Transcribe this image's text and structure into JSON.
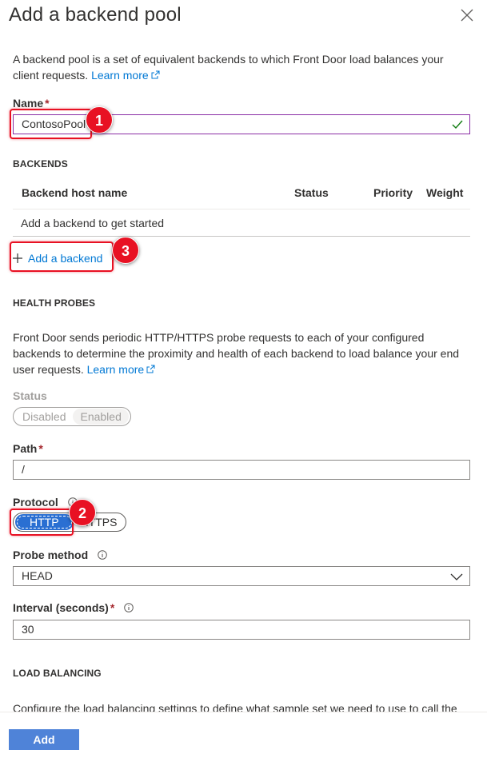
{
  "panel": {
    "title": "Add a backend pool"
  },
  "intro": {
    "text": "A backend pool is a set of equivalent backends to which Front Door load balances your client requests.",
    "link": "Learn more"
  },
  "name_field": {
    "label": "Name",
    "required_mark": "*",
    "value": "ContosoPool"
  },
  "backends": {
    "heading": "BACKENDS",
    "columns": [
      "Backend host name",
      "Status",
      "Priority",
      "Weight"
    ],
    "empty_text": "Add a backend to get started",
    "add_label": "Add a backend"
  },
  "health_probes": {
    "heading": "HEALTH PROBES",
    "text": "Front Door sends periodic HTTP/HTTPS probe requests to each of your configured backends to determine the proximity and health of each backend to load balance your end user requests.",
    "link": "Learn more",
    "status": {
      "label": "Status",
      "options": [
        "Disabled",
        "Enabled"
      ],
      "selected": "Enabled",
      "disabled": true
    },
    "path": {
      "label": "Path",
      "required_mark": "*",
      "value": "/"
    },
    "protocol": {
      "label": "Protocol",
      "options": [
        "HTTP",
        "HTTPS"
      ],
      "selected": "HTTP"
    },
    "probe_method": {
      "label": "Probe method",
      "value": "HEAD"
    },
    "interval": {
      "label": "Interval (seconds)",
      "required_mark": "*",
      "value": "30"
    }
  },
  "load_balancing": {
    "heading": "LOAD BALANCING",
    "text": "Configure the load balancing settings to define what sample set we need to use to call the"
  },
  "callouts": [
    "1",
    "2",
    "3"
  ],
  "footer": {
    "add_label": "Add"
  },
  "colors": {
    "accent": "#0078d4",
    "primary_button": "#4f83d8",
    "callout": "#e81123",
    "valid_border": "#8a2da5",
    "valid_check": "#107c10"
  },
  "icons": [
    "close-icon",
    "external-link-icon",
    "checkmark-icon",
    "plus-icon",
    "info-icon",
    "chevron-down-icon"
  ]
}
